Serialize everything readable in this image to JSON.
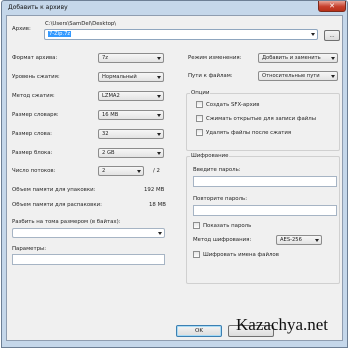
{
  "window": {
    "title": "Добавить к архиву",
    "close_icon": "close-icon"
  },
  "archive": {
    "label": "Архив:",
    "path": "C:\\Users\\SamDel\\Desktop\\",
    "filename": "7-Zip.7z",
    "browse_label": "..."
  },
  "left": {
    "format_label": "Формат архива:",
    "format_value": "7z",
    "level_label": "Уровень сжатия:",
    "level_value": "Нормальный",
    "method_label": "Метод сжатия:",
    "method_value": "LZMA2",
    "dict_label": "Размер словаря:",
    "dict_value": "16 MB",
    "word_label": "Размер слова:",
    "word_value": "32",
    "block_label": "Размер блока:",
    "block_value": "2 GB",
    "threads_label": "Число потоков:",
    "threads_value": "2",
    "threads_max": "/ 2",
    "mem_pack_label": "Объем памяти для упаковки:",
    "mem_pack_value": "192 MB",
    "mem_unpack_label": "Объем памяти для распаковки:",
    "mem_unpack_value": "18 MB",
    "split_label": "Разбить на тома размером (в байтах):",
    "params_label": "Параметры:"
  },
  "right": {
    "update_label": "Режим изменения:",
    "update_value": "Добавить и заменить",
    "paths_label": "Пути к файлам:",
    "paths_value": "Относительные пути",
    "options_title": "Опции",
    "opt_sfx": "Создать SFX-архив",
    "opt_shared": "Сжимать открытые для записи файлы",
    "opt_delete": "Удалять файлы после сжатия",
    "encryption_title": "Шифрование",
    "password_label": "Введите пароль:",
    "repeat_label": "Повторите пароль:",
    "show_password": "Показать пароль",
    "enc_method_label": "Метод шифрования:",
    "enc_method_value": "AES-256",
    "encrypt_names": "Шифровать имена файлов"
  },
  "buttons": {
    "ok": "OK"
  },
  "watermark": "Kazachya.net"
}
